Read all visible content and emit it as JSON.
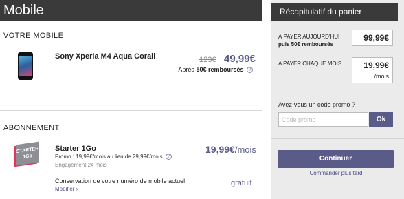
{
  "header": {
    "title": "Mobile"
  },
  "mobile_section": {
    "title": "VOTRE MOBILE",
    "product_name": "Sony Xperia M4 Aqua Corail",
    "old_price": "123€",
    "new_price": "49,99€",
    "refund_prefix": "Après",
    "refund_amount": "50€ remboursés",
    "help_glyph": "?"
  },
  "subscription_section": {
    "title": "ABONNEMENT",
    "logo_text_1": "STARTER",
    "logo_text_2": "1Go",
    "offer_name": "Starter 1Go",
    "promo_text": "Promo : 19,99€/mois au lieu de 29,99€/mois",
    "engagement": "Engagement 24 mois",
    "price": "19,99€",
    "price_unit": "/mois",
    "keep_number": "Conservation de votre numéro de mobile actuel",
    "modify_link": "Modifier",
    "modify_chevron": "›",
    "keep_price": "gratuit"
  },
  "cart": {
    "title": "Récapitulatif du panier",
    "pay_today_label": "À PAYER AUJOURD'HUI",
    "pay_today_sub": "puis 50€ remboursés",
    "pay_today_value": "99,99€",
    "pay_monthly_label": "A PAYER CHAQUE MOIS",
    "pay_monthly_value": "19,99€",
    "pay_monthly_unit": "/mois",
    "promo_question": "Avez-vous un code promo ?",
    "promo_placeholder": "Code promo",
    "ok_label": "Ok",
    "continue_label": "Continuer",
    "later_link": "Commander plus tard"
  },
  "colors": {
    "header_bg": "#3a3a3a",
    "accent": "#5b5b8a",
    "panel_bg": "#ebebeb",
    "starter_red": "#e4335c"
  }
}
